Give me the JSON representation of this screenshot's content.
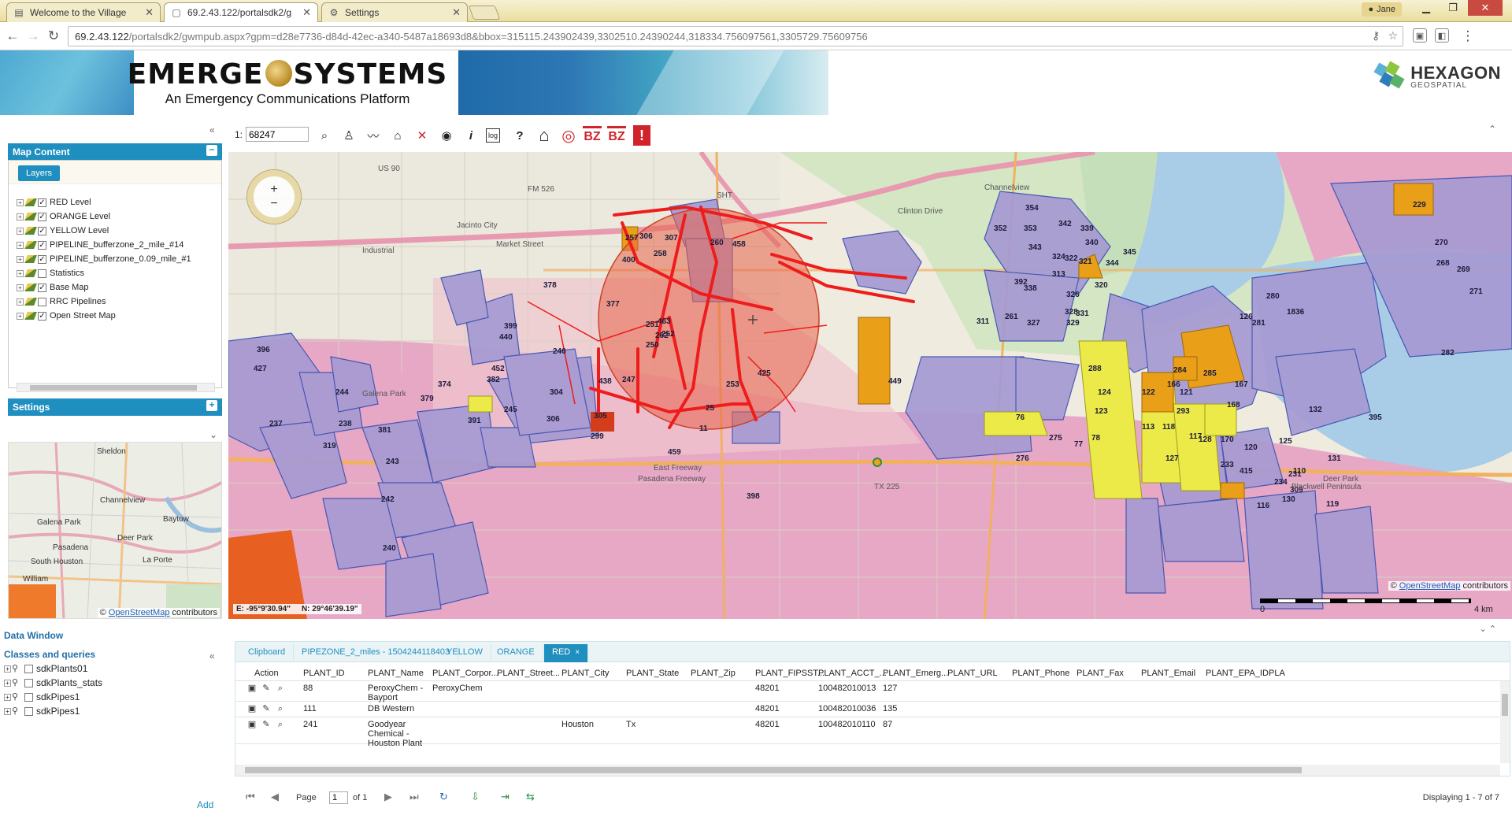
{
  "browser": {
    "tabs": [
      {
        "title": "Welcome to the Village",
        "icon": "page-icon"
      },
      {
        "title": "69.2.43.122/portalsdk2/g",
        "icon": "page-icon"
      },
      {
        "title": "Settings",
        "icon": "gear-icon"
      }
    ],
    "user": "Jane",
    "url_host": "69.2.43.122",
    "url_rest": "/portalsdk2/gwmpub.aspx?gpm=d28e7736-d84d-42ec-a340-5487a18693d8&bbox=315115.243902439,3302510.24390244,318334.756097561,3305729.75609756"
  },
  "banner": {
    "title_left": "EMERGE",
    "title_right": "SYSTEMS",
    "subtitle": "An Emergency Communications Platform",
    "partner_title": "HEXAGON",
    "partner_sub": "GEOSPATIAL"
  },
  "left": {
    "map_content_title": "Map Content",
    "layers_tab": "Layers",
    "layers": [
      {
        "label": "RED Level",
        "checked": true
      },
      {
        "label": "ORANGE Level",
        "checked": true
      },
      {
        "label": "YELLOW Level",
        "checked": true
      },
      {
        "label": "PIPELINE_bufferzone_2_mile_#14",
        "checked": true
      },
      {
        "label": "PIPELINE_bufferzone_0.09_mile_#1",
        "checked": true
      },
      {
        "label": "Statistics",
        "checked": false
      },
      {
        "label": "Base Map",
        "checked": true
      },
      {
        "label": "RRC Pipelines",
        "checked": false
      },
      {
        "label": "Open Street Map",
        "checked": true
      }
    ],
    "settings_title": "Settings",
    "overview_labels": [
      "Sheldon",
      "Channelview",
      "Galena Park",
      "Baytow",
      "Deer Park",
      "Pasadena",
      "South Houston",
      "La Porte",
      "William"
    ],
    "overview_attrib_link": "OpenStreetMap",
    "overview_attrib_text": "contributors",
    "data_window_title": "Data Window",
    "classes_title": "Classes and queries",
    "classes": [
      "sdkPlants01",
      "sdkPlants_stats",
      "sdkPipes1",
      "sdkPipes1"
    ],
    "add_label": "Add"
  },
  "toolbar": {
    "scale_prefix": "1:",
    "scale_value": "68247",
    "tools": [
      "zoom-icon",
      "user-icon",
      "line-icon",
      "bell-icon",
      "remove-icon",
      "eye-icon",
      "info-icon",
      "log-icon",
      "help-icon",
      "home-icon",
      "target-icon",
      "bz-icon",
      "bz-icon",
      "alert-icon"
    ],
    "info_glyph": "i",
    "help_glyph": "?",
    "log_glyph": "log",
    "bz_label": "BZ",
    "alert_glyph": "!"
  },
  "map": {
    "coord_e": "E: -95°9'30.94\"",
    "coord_n": "N: 29°46'39.19\"",
    "attrib_link": "OpenStreetMap",
    "attrib_text": "contributors",
    "scale_labels": [
      "0",
      "4 km"
    ],
    "road_labels": [
      "US 90",
      "FM 526",
      "SHT",
      "Jacinto City",
      "Market Street",
      "Industrial",
      "Galena Park",
      "Clinton Drive",
      "Channelview",
      "East Freeway",
      "Pasadena Freeway",
      "TX 225",
      "Deer Park",
      "Blackwell Peninsula"
    ],
    "parcel_labels": [
      "354",
      "352",
      "353",
      "343",
      "342",
      "339",
      "340",
      "344",
      "345",
      "324",
      "322",
      "321",
      "320",
      "313",
      "326",
      "328",
      "329",
      "331",
      "327",
      "261",
      "311",
      "338",
      "392",
      "257",
      "306",
      "307",
      "258",
      "400",
      "260",
      "458",
      "378",
      "377",
      "463",
      "251",
      "262",
      "252",
      "250",
      "246",
      "438",
      "247",
      "449",
      "253",
      "425",
      "25",
      "11",
      "305",
      "245",
      "304",
      "306",
      "299",
      "391",
      "399",
      "440",
      "396",
      "427",
      "452",
      "374",
      "382",
      "379",
      "244",
      "238",
      "237",
      "319",
      "381",
      "243",
      "242",
      "240",
      "459",
      "398",
      "276",
      "275",
      "76",
      "77",
      "78",
      "123",
      "124",
      "288",
      "122",
      "293",
      "121",
      "118",
      "117",
      "127",
      "128",
      "233",
      "113",
      "415",
      "116",
      "110",
      "234",
      "130",
      "309",
      "131",
      "231",
      "119",
      "132",
      "395",
      "120",
      "125",
      "170",
      "168",
      "167",
      "166",
      "284",
      "285",
      "126",
      "281",
      "1836",
      "280",
      "270",
      "268",
      "269",
      "271",
      "229",
      "282"
    ]
  },
  "grid": {
    "tabs": [
      {
        "label": "Clipboard"
      },
      {
        "label": "PIPEZONE_2_miles - 1504244118403"
      },
      {
        "label": "YELLOW"
      },
      {
        "label": "ORANGE"
      },
      {
        "label": "RED",
        "active": true
      }
    ],
    "close_glyph": "×",
    "columns": [
      "Action",
      "PLANT_ID",
      "PLANT_Name",
      "PLANT_Corpor...",
      "PLANT_Street...",
      "PLANT_City",
      "PLANT_State",
      "PLANT_Zip",
      "PLANT_FIPSST...",
      "PLANT_ACCT_...",
      "PLANT_Emerg...",
      "PLANT_URL",
      "PLANT_Phone",
      "PLANT_Fax",
      "PLANT_Email",
      "PLANT_EPA_ID",
      "PLA"
    ],
    "rows": [
      {
        "id": "88",
        "name": "PeroxyChem - Bayport",
        "corp": "PeroxyChem",
        "street": "",
        "city": "",
        "state": "",
        "zip": "",
        "fips": "48201",
        "acct": "100482010013",
        "emerg": "127"
      },
      {
        "id": "111",
        "name": "DB Western",
        "corp": "",
        "street": "",
        "city": "",
        "state": "",
        "zip": "",
        "fips": "48201",
        "acct": "100482010036",
        "emerg": "135"
      },
      {
        "id": "241",
        "name": "Goodyear Chemical - Houston Plant",
        "corp": "",
        "street": "",
        "city": "Houston",
        "state": "Tx",
        "zip": "",
        "fips": "48201",
        "acct": "100482010110",
        "emerg": "87"
      }
    ],
    "pager_page_label": "Page",
    "pager_page_value": "1",
    "pager_of": "of 1",
    "displaying": "Displaying 1 - 7 of 7"
  }
}
